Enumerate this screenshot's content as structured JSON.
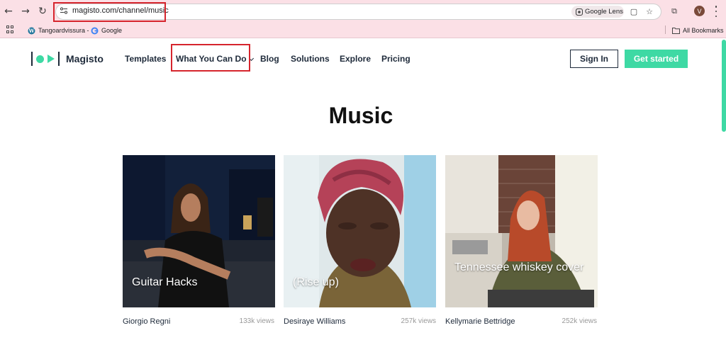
{
  "browser": {
    "url": "magisto.com/channel/music",
    "google_lens_label": "Google Lens",
    "avatar_letter": "V",
    "bookmarks": [
      {
        "label": "Tangoardvissura -",
        "icon": "wordpress-icon"
      },
      {
        "label": "Google",
        "icon": "google-icon"
      }
    ],
    "all_bookmarks_label": "All Bookmarks"
  },
  "header": {
    "brand": "Magisto",
    "nav": [
      {
        "label": "Templates"
      },
      {
        "label": "What You Can Do"
      },
      {
        "label": "Blog"
      },
      {
        "label": "Solutions"
      },
      {
        "label": "Explore"
      },
      {
        "label": "Pricing"
      }
    ],
    "sign_in": "Sign In",
    "get_started": "Get started"
  },
  "page": {
    "title": "Music"
  },
  "cards": [
    {
      "title": "Guitar Hacks",
      "author": "Giorgio Regni",
      "views": "133k views"
    },
    {
      "title": "(Rise up)",
      "author": "Desiraye Williams",
      "views": "257k views"
    },
    {
      "title": "Tennessee whiskey cover",
      "author": "Kellymarie Bettridge",
      "views": "252k views"
    }
  ],
  "colors": {
    "accent": "#3ed9a4",
    "brand_dark": "#1e2a3a",
    "highlight": "#d6252d",
    "chrome": "#fbe0e6"
  }
}
